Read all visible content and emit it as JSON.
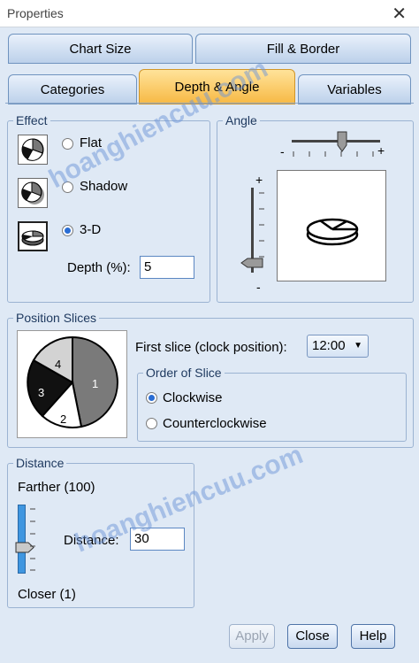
{
  "window": {
    "title": "Properties",
    "close_glyph": "✕"
  },
  "tabs_row1": [
    "Chart Size",
    "Fill & Border"
  ],
  "tabs_row2": [
    "Categories",
    "Depth & Angle",
    "Variables"
  ],
  "active_tab": "Depth & Angle",
  "effect": {
    "legend": "Effect",
    "options": [
      "Flat",
      "Shadow",
      "3-D"
    ],
    "selected": "3-D",
    "depth_label": "Depth (%):",
    "depth_value": "5"
  },
  "angle": {
    "legend": "Angle",
    "plus": "+",
    "minus": "-"
  },
  "position_slices": {
    "legend": "Position Slices",
    "first_slice_label": "First slice (clock position):",
    "first_slice_value": "12:00",
    "order_legend": "Order of Slice",
    "order_options": [
      "Clockwise",
      "Counterclockwise"
    ],
    "order_selected": "Clockwise",
    "pie_labels": [
      "1",
      "2",
      "3",
      "4"
    ]
  },
  "distance": {
    "legend": "Distance",
    "farther_label": "Farther (100)",
    "closer_label": "Closer (1)",
    "distance_label": "Distance:",
    "distance_value": "30"
  },
  "buttons": {
    "apply": "Apply",
    "close": "Close",
    "help": "Help"
  },
  "watermark": "hoanghiencuu.com",
  "colors": {
    "accent_tab": "#f7b944",
    "border": "#9bb3d2",
    "background": "#dfe9f5"
  }
}
